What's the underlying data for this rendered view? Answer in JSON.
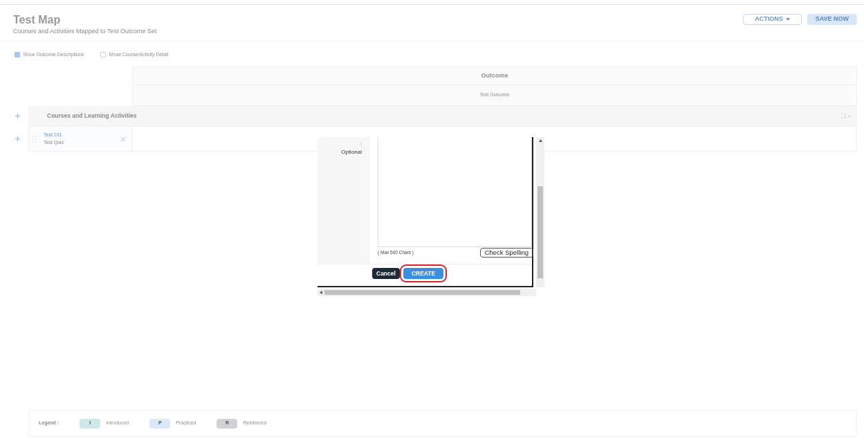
{
  "header": {
    "title": "Test Map",
    "subtitle": "Courses and Activities Mapped to Test Outcome Set",
    "actions_button": "ACTIONS",
    "save_button": "SAVE NOW"
  },
  "options": [
    {
      "label": "Show Outcome Descriptions",
      "checked": true
    },
    {
      "label": "Show Course/Activity Detail",
      "checked": false
    }
  ],
  "table": {
    "outcome_heading": "Outcome",
    "outcome_name": "Test Outcome",
    "courses_heading": "Courses and Learning Activities",
    "rows": [
      {
        "course": "Test 101",
        "activity": "Test Quiz"
      }
    ]
  },
  "dialog": {
    "colon": ":",
    "field_label": "Optional",
    "char_limit": "( Max 500 Chars )",
    "spell_button": "Check Spelling",
    "cancel_button": "Cancel",
    "create_button": "CREATE"
  },
  "legend": {
    "label": "Legend :",
    "items": [
      {
        "letter": "I",
        "name": "Introduced",
        "color": "#cfe8ea"
      },
      {
        "letter": "P",
        "name": "Practiced",
        "color": "#d9e9fa"
      },
      {
        "letter": "R",
        "name": "Reinforced",
        "color": "#d0d2d5"
      }
    ]
  }
}
